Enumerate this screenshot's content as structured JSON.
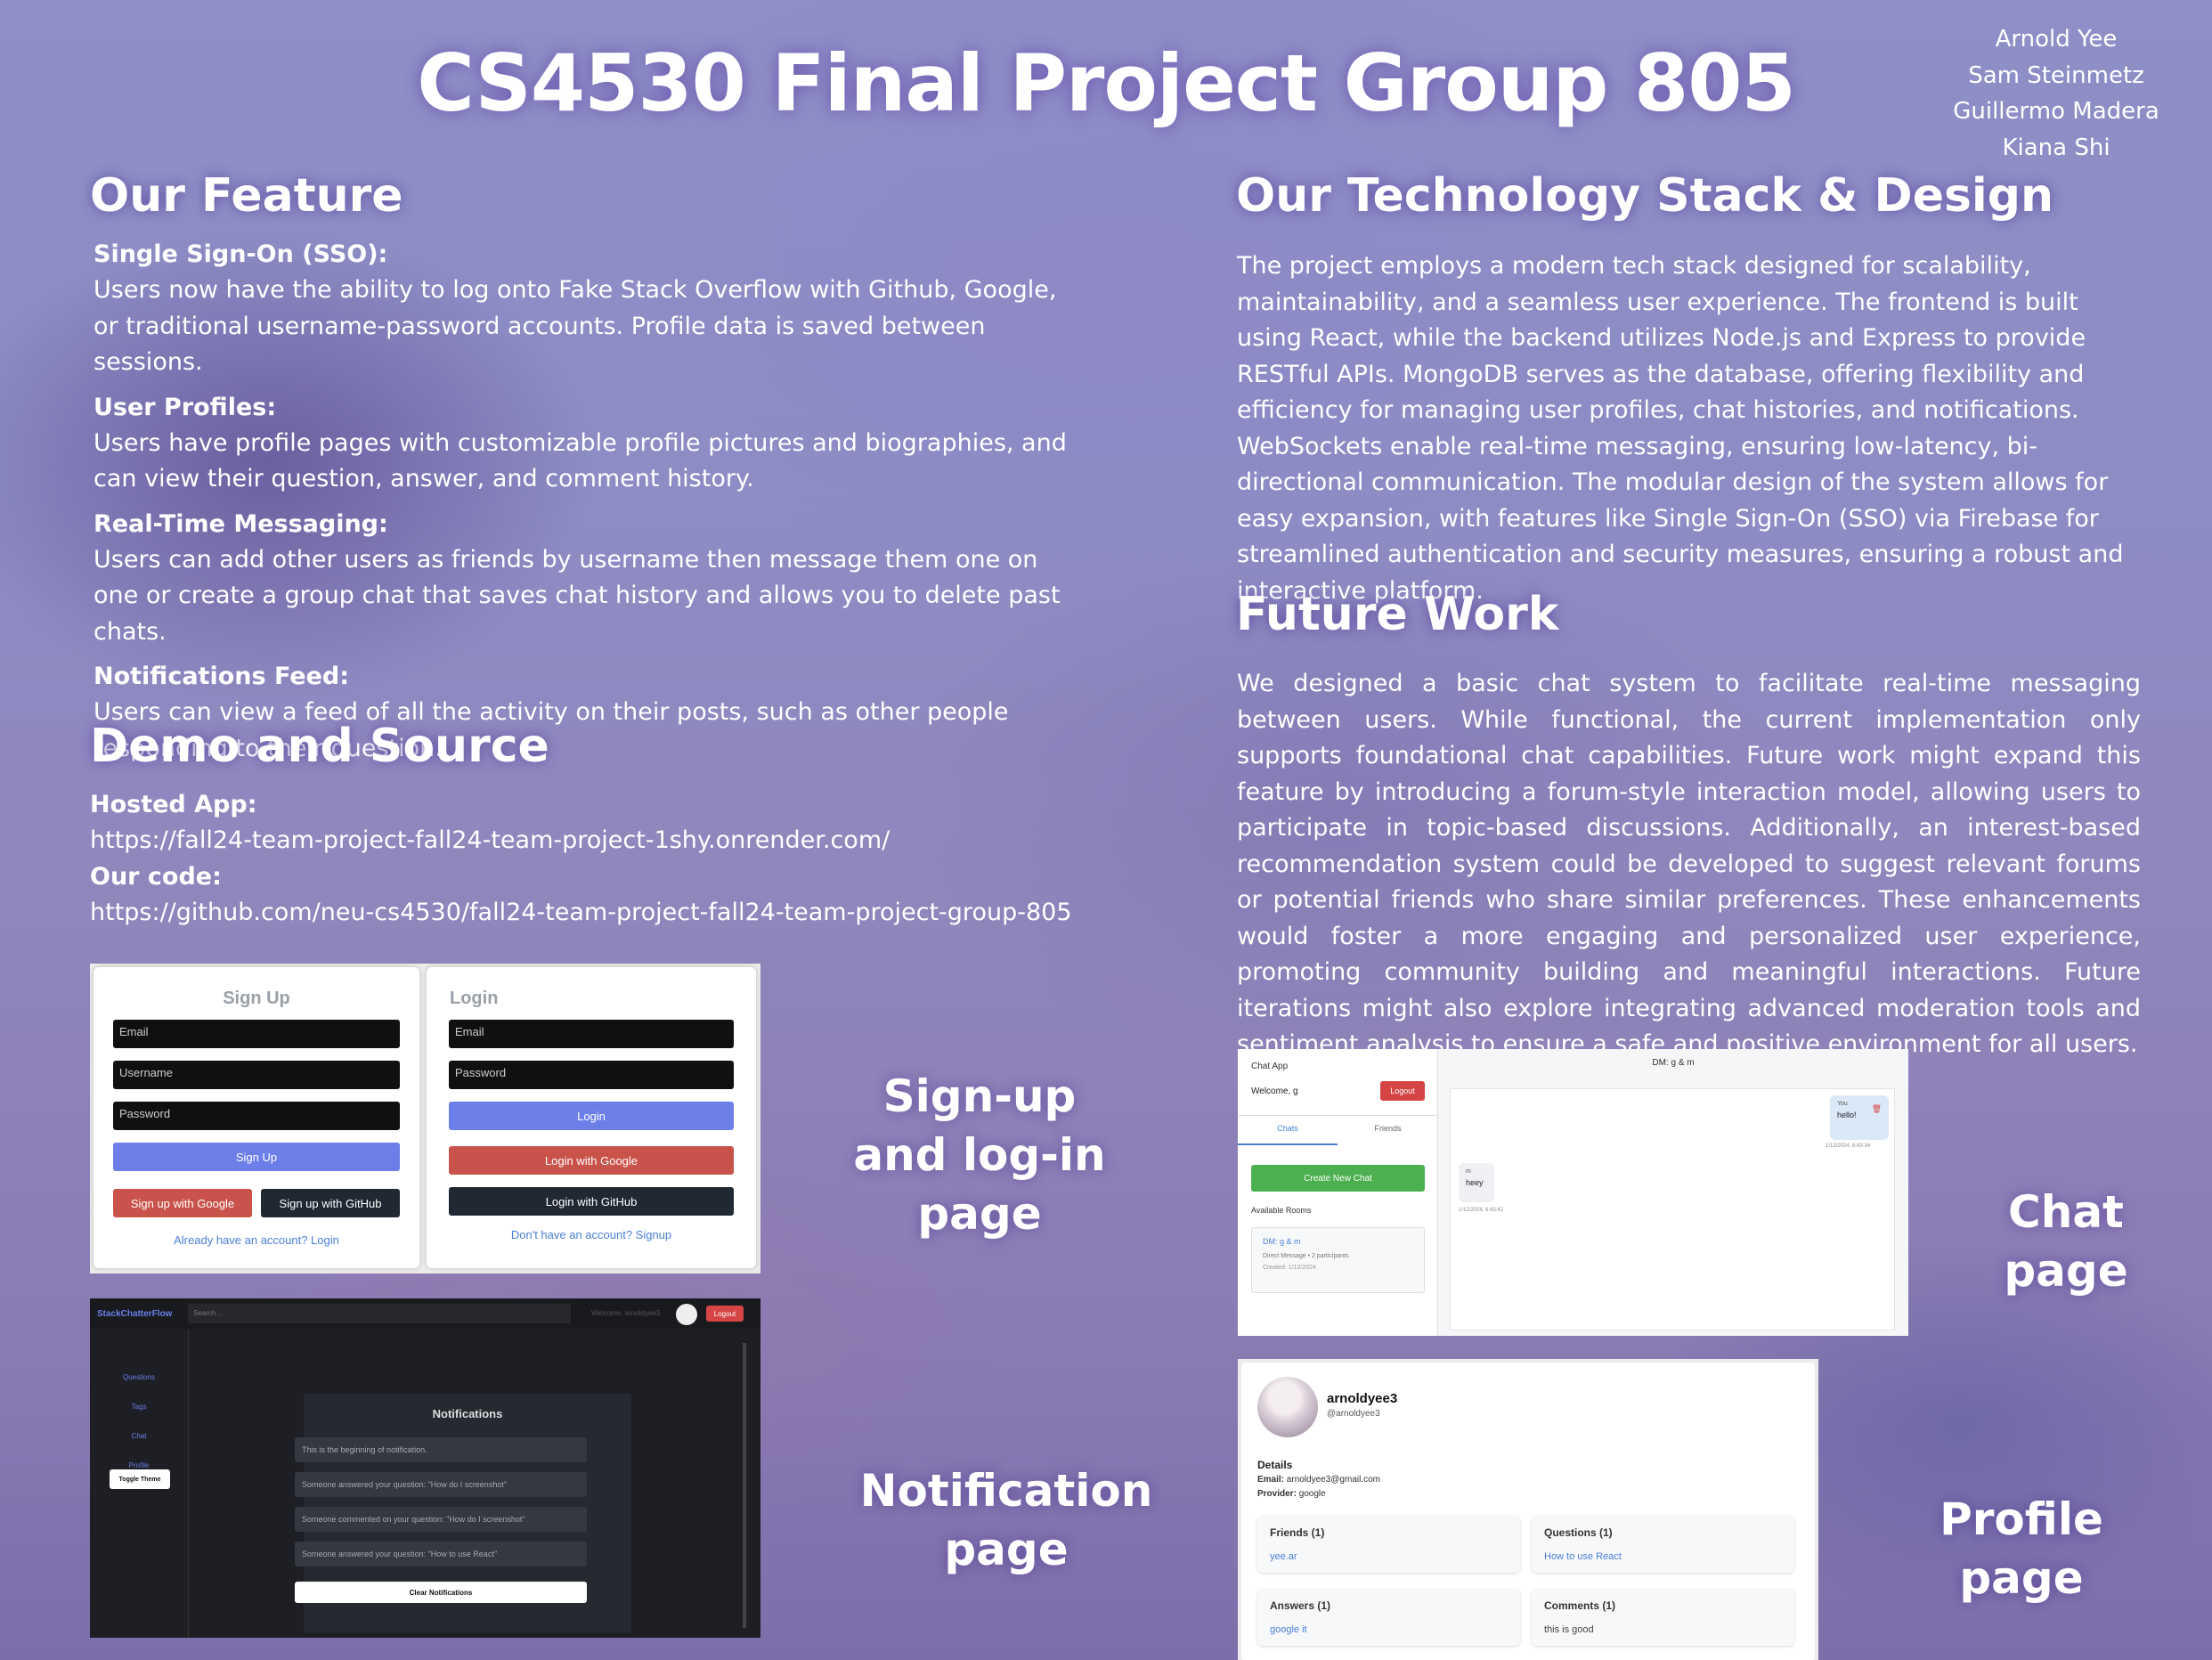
{
  "title": "CS4530 Final Project Group 805",
  "authors": [
    "Arnold Yee",
    "Sam Steinmetz",
    "Guillermo Madera",
    "Kiana Shi"
  ],
  "feature": {
    "heading": "Our Feature",
    "items": [
      {
        "title": "Single Sign-On (SSO):",
        "text": "Users now have the ability to log onto Fake Stack Overflow with Github, Google, or traditional username-password accounts. Profile data is saved between sessions."
      },
      {
        "title": "User Profiles:",
        "text": "Users have profile pages with customizable profile pictures and biographies, and can view their question, answer, and comment history."
      },
      {
        "title": "Real-Time Messaging:",
        "text": "Users can add other users as friends by username then message them one on one or create a group chat that saves chat history and allows you to delete past chats."
      },
      {
        "title": "Notifications Feed:",
        "text": "Users can view a feed of all the activity on their posts, such as other people responding to their question."
      }
    ]
  },
  "demo": {
    "heading": "Demo and Source",
    "hosted_label": "Hosted App:",
    "hosted_url": "https://fall24-team-project-fall24-team-project-1shy.onrender.com/",
    "code_label": "Our code:",
    "code_url": "https://github.com/neu-cs4530/fall24-team-project-fall24-team-project-group-805"
  },
  "tech": {
    "heading": "Our Technology Stack & Design",
    "text": "The project employs a modern tech stack designed for scalability, maintainability, and a seamless user experience. The frontend is built using React, while the backend utilizes Node.js and Express to provide RESTful APIs. MongoDB serves as the database, offering flexibility and efficiency for managing user profiles, chat histories, and notifications. WebSockets enable real-time messaging, ensuring low-latency, bi-directional communication. The modular design of the system allows for easy expansion, with features like Single Sign-On (SSO) via Firebase for streamlined authentication and security measures, ensuring a robust and interactive platform."
  },
  "future": {
    "heading": "Future Work",
    "text": "We designed a basic chat system to facilitate real-time messaging between users. While functional, the current implementation only supports foundational chat capabilities. Future work might expand this feature by introducing a forum-style interaction model, allowing users to participate in topic-based discussions. Additionally, an interest-based recommendation system could be developed to suggest relevant forums or potential friends who share similar preferences. These enhancements would foster a more engaging and personalized user experience, promoting community building and meaningful interactions. Future iterations might also explore integrating advanced moderation tools and sentiment analysis to ensure a safe and positive environment for all users."
  },
  "labels": {
    "signup": "Sign-up and log-in page",
    "notification": "Notification page",
    "chat": "Chat page",
    "profile": "Profile page"
  },
  "signup_card": {
    "title": "Sign Up",
    "email": "Email",
    "username": "Username",
    "password": "Password",
    "submit": "Sign Up",
    "google": "Sign up with Google",
    "github": "Sign up with GitHub",
    "link": "Already have an account? Login"
  },
  "login_card": {
    "title": "Login",
    "email": "Email",
    "password": "Password",
    "submit": "Login",
    "google": "Login with Google",
    "github": "Login with GitHub",
    "link": "Don't have an account? Signup"
  },
  "notif_screen": {
    "brand": "StackChatterFlow",
    "search_placeholder": "Search ...",
    "welcome": "Welcome, arnoldyee3",
    "logout": "Logout",
    "nav": [
      "Questions",
      "Tags",
      "Chat",
      "Profile"
    ],
    "toggle": "Toggle Theme",
    "panel_title": "Notifications",
    "items": [
      "This is the beginning of notification.",
      "Someone answered your question: \"How do I screenshot\"",
      "Someone commented on your question: \"How do I screenshot\"",
      "Someone answered your question: \"How to use React\""
    ],
    "clear": "Clear Notifications"
  },
  "chat_screen": {
    "app": "Chat App",
    "welcome": "Welcome, g",
    "logout": "Logout",
    "tab_chats": "Chats",
    "tab_friends": "Friends",
    "new_chat": "Create New Chat",
    "rooms_label": "Available Rooms",
    "room": {
      "name": "DM: g & m",
      "meta": "Direct Message • 2 participants",
      "created": "Created: 1/12/2024"
    },
    "header": "DM: g & m",
    "msg_out": {
      "sender": "You",
      "text": "hello!",
      "time": "1/12/2024, 6:43:34"
    },
    "msg_in": {
      "sender": "m",
      "text": "heey",
      "time": "1/12/2024, 6:43:42"
    }
  },
  "profile_screen": {
    "name": "arnoldyee3",
    "handle": "@arnoldyee3",
    "details": "Details",
    "email_label": "Email:",
    "email": "arnoldyee3@gmail.com",
    "provider_label": "Provider:",
    "provider": "google",
    "friends": {
      "h": "Friends (1)",
      "v": "yee.ar"
    },
    "questions": {
      "h": "Questions (1)",
      "v": "How to use React"
    },
    "answers": {
      "h": "Answers (1)",
      "v": "google it"
    },
    "comments": {
      "h": "Comments (1)",
      "v": "this is good"
    }
  },
  "colors": {
    "primary_button": "#6c7ee8",
    "google_button": "#c9534a",
    "github_button": "#1f2833",
    "logout": "#d64545",
    "chat_green": "#4caf50"
  }
}
